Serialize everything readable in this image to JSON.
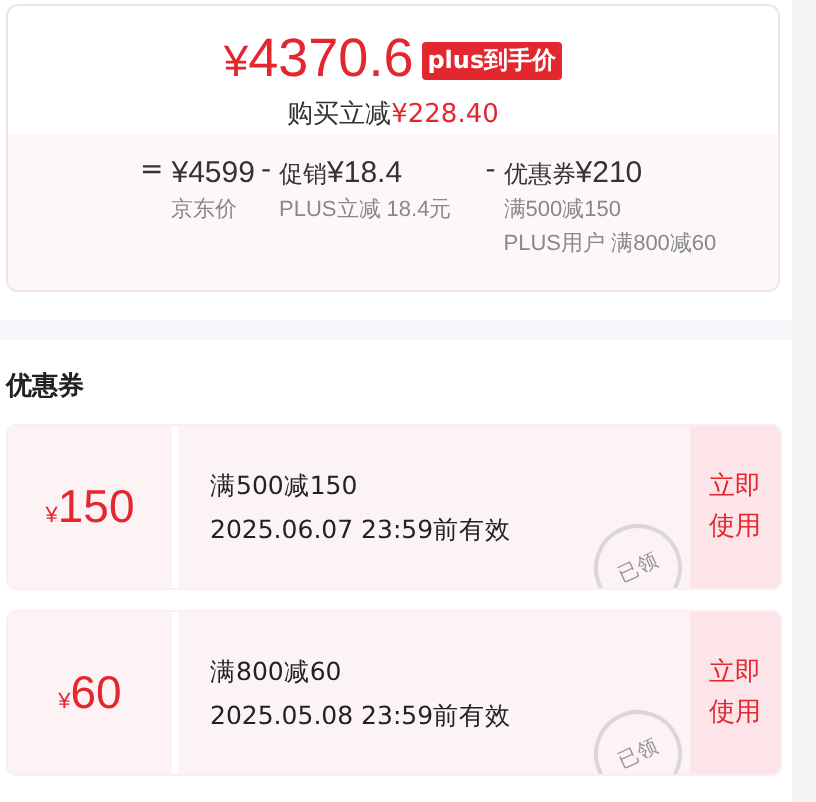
{
  "price": {
    "currency": "¥",
    "amount": "4370.6",
    "badge": "plus到手价",
    "saving_label": "购买立减",
    "saving": "¥228.40"
  },
  "breakdown": [
    {
      "op": "=",
      "value": "¥4599",
      "notes": [
        "京东价"
      ]
    },
    {
      "op": "-",
      "title": "促销",
      "value": "¥18.4",
      "notes": [
        "PLUS立减 18.4元"
      ]
    },
    {
      "op": "-",
      "title": "优惠券",
      "value": "¥210",
      "notes": [
        "满500减150",
        "PLUS用户 满800减60"
      ]
    }
  ],
  "coupons_title": "优惠券",
  "coupons": [
    {
      "currency": "¥",
      "amount": "150",
      "rule": "满500减150",
      "validity": "2025.06.07 23:59前有效",
      "stamp": "已领",
      "action": "立即使用"
    },
    {
      "currency": "¥",
      "amount": "60",
      "rule": "满800减60",
      "validity": "2025.05.08 23:59前有效",
      "stamp": "已领",
      "action": "立即使用"
    }
  ]
}
